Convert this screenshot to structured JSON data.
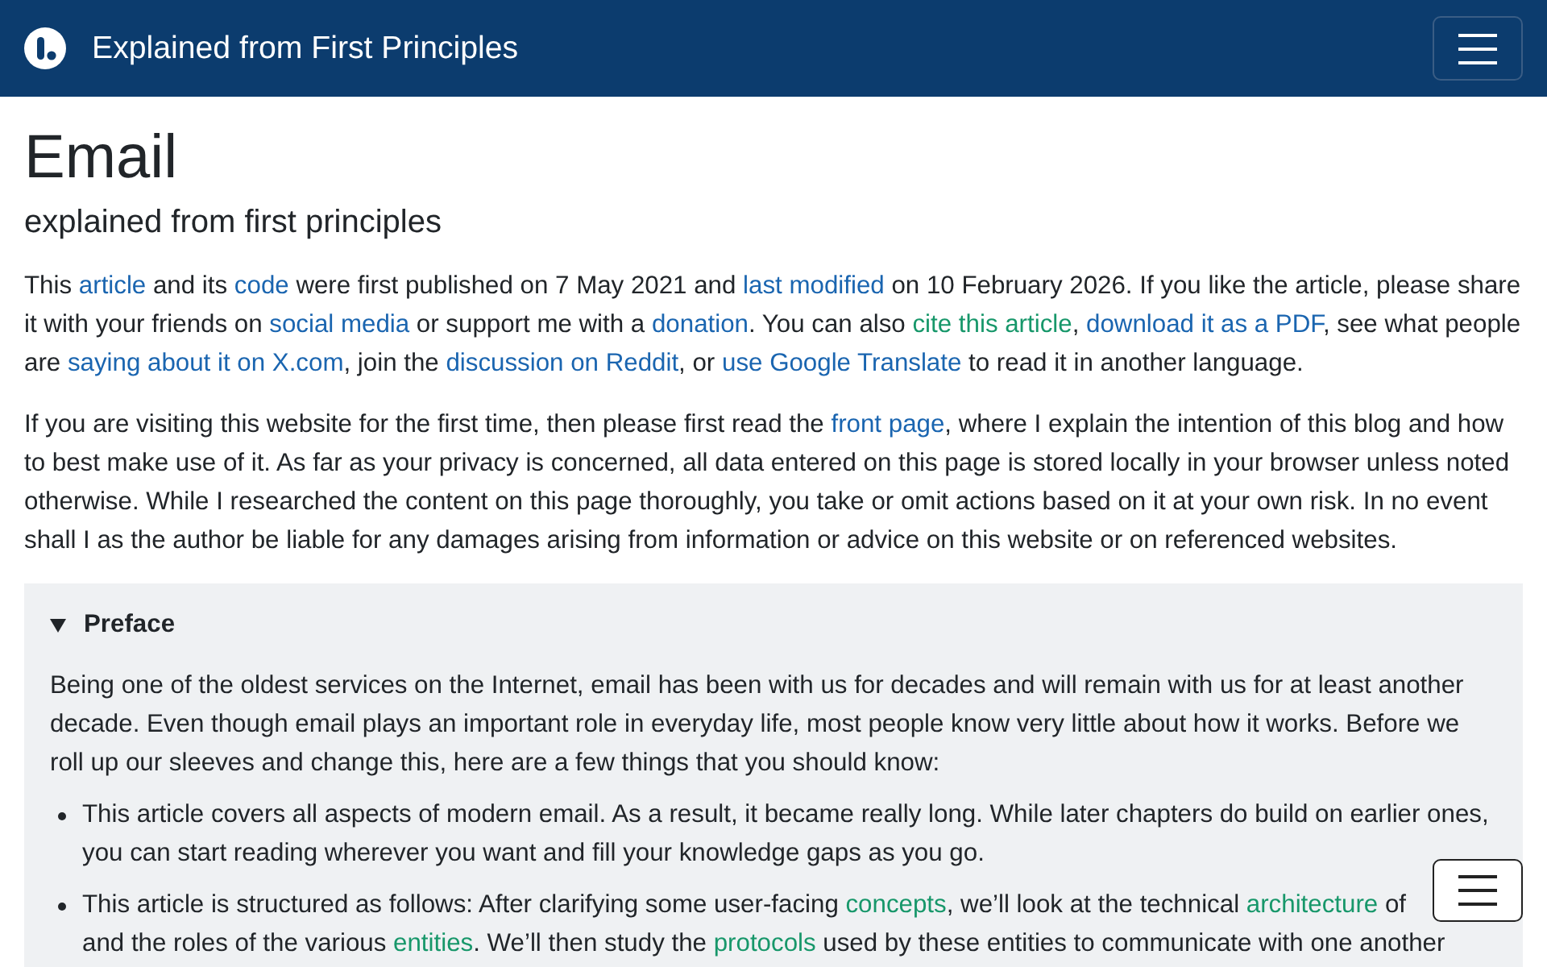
{
  "header": {
    "title": "Explained from First Principles"
  },
  "article": {
    "title": "Email",
    "subtitle": "explained from first principles",
    "paragraphs": [
      {
        "segments": [
          {
            "kind": "text",
            "text": "This "
          },
          {
            "kind": "link",
            "text": "article"
          },
          {
            "kind": "text",
            "text": " and its "
          },
          {
            "kind": "link",
            "text": "code"
          },
          {
            "kind": "text",
            "text": " were first published on 7 May 2021 and "
          },
          {
            "kind": "link",
            "text": "last modified"
          },
          {
            "kind": "text",
            "text": " on 10 February 2026. If you like the article, please share it with your friends on "
          },
          {
            "kind": "link",
            "text": "social media"
          },
          {
            "kind": "text",
            "text": " or support me with a "
          },
          {
            "kind": "link",
            "text": "donation"
          },
          {
            "kind": "text",
            "text": ". You can also "
          },
          {
            "kind": "anchor",
            "text": "cite this article"
          },
          {
            "kind": "text",
            "text": ", "
          },
          {
            "kind": "link",
            "text": "download it as a PDF"
          },
          {
            "kind": "text",
            "text": ", see what people are "
          },
          {
            "kind": "link",
            "text": "saying about it on X.com"
          },
          {
            "kind": "text",
            "text": ", join the "
          },
          {
            "kind": "link",
            "text": "discussion on Reddit"
          },
          {
            "kind": "text",
            "text": ", or "
          },
          {
            "kind": "link",
            "text": "use Google Translate"
          },
          {
            "kind": "text",
            "text": " to read it in another language."
          }
        ]
      },
      {
        "segments": [
          {
            "kind": "text",
            "text": "If you are visiting this website for the first time, then please first read the "
          },
          {
            "kind": "link",
            "text": "front page"
          },
          {
            "kind": "text",
            "text": ", where I explain the intention of this blog and how to best make use of it. As far as your privacy is concerned, all data entered on this page is stored locally in your browser unless noted otherwise. While I researched the content on this page thoroughly, you take or omit actions based on it at your own risk. In no event shall I as the author be liable for any damages arising from information or advice on this website or on referenced websites."
          }
        ]
      }
    ]
  },
  "preface": {
    "title": "Preface",
    "expanded": true,
    "paragraphs": [
      {
        "segments": [
          {
            "kind": "text",
            "text": "Being one of the oldest services on the Internet, email has been with us for decades and will remain with us for at least another decade. Even though email plays an important role in everyday life, most people know very little about how it works. Before we roll up our sleeves and change this, here are a few things that you should know:"
          }
        ]
      }
    ],
    "items": [
      {
        "segments": [
          {
            "kind": "text",
            "text": "This article covers all aspects of modern email. As a result, it became really long. While later chapters do build on earlier ones, you can start reading wherever you want and fill your knowledge gaps as you go."
          }
        ]
      },
      {
        "segments": [
          {
            "kind": "text",
            "text": "This article is structured as follows: After clarifying some user-facing "
          },
          {
            "kind": "anchor",
            "text": "concepts"
          },
          {
            "kind": "text",
            "text": ", we’ll look at the technical "
          },
          {
            "kind": "anchor",
            "text": "architecture"
          },
          {
            "kind": "text",
            "text": " of "
          },
          {
            "kind": "text",
            "text": "and the roles of the various "
          },
          {
            "kind": "anchor",
            "text": "entities"
          },
          {
            "kind": "text",
            "text": ". We’ll then study the "
          },
          {
            "kind": "anchor",
            "text": "protocols"
          },
          {
            "kind": "text",
            "text": " used by these entities to communicate with one another"
          }
        ]
      }
    ]
  }
}
